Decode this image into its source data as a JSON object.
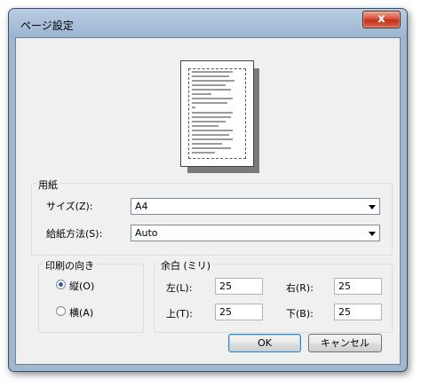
{
  "window": {
    "title": "ページ設定",
    "close_label": "x"
  },
  "paper": {
    "group_label": "用紙",
    "size_label": "サイズ(Z):",
    "size_value": "A4",
    "source_label": "給紙方法(S):",
    "source_value": "Auto"
  },
  "orientation": {
    "group_label": "印刷の向き",
    "portrait_label": "縦(O)",
    "landscape_label": "横(A)",
    "selected": "portrait"
  },
  "margins": {
    "group_label": "余白 (ミリ)",
    "left_label": "左(L):",
    "left_value": "25",
    "right_label": "右(R):",
    "right_value": "25",
    "top_label": "上(T):",
    "top_value": "25",
    "bottom_label": "下(B):",
    "bottom_value": "25"
  },
  "buttons": {
    "ok_label": "OK",
    "cancel_label": "キャンセル"
  },
  "colors": {
    "title_bar": "#a9c1da",
    "close_button": "#c7412a",
    "dialog_bg": "#f0f0f0"
  },
  "icons": {
    "close": "close-icon",
    "dropdown": "chevron-down-icon"
  }
}
